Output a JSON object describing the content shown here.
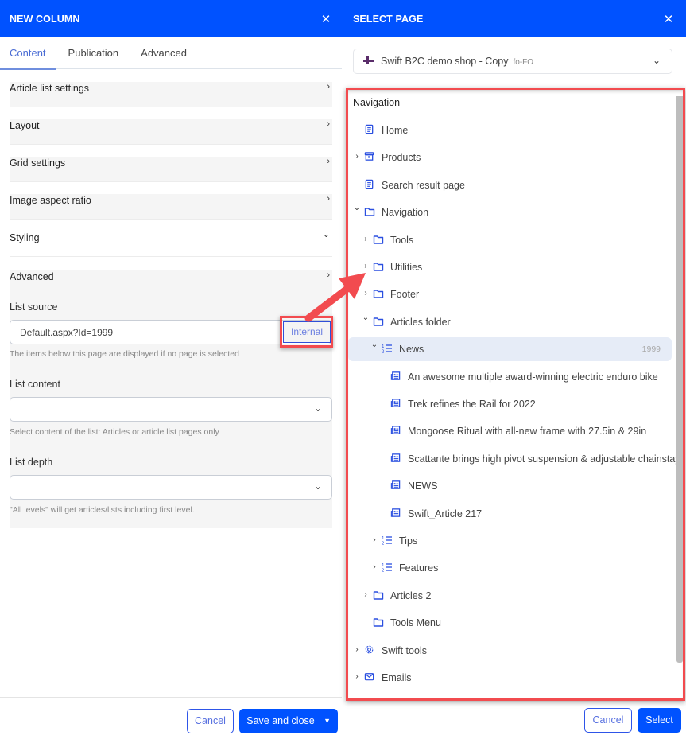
{
  "left_panel": {
    "title": "NEW COLUMN",
    "close_icon": "close-icon",
    "tabs": [
      {
        "label": "Content",
        "active": true
      },
      {
        "label": "Publication",
        "active": false
      },
      {
        "label": "Advanced",
        "active": false
      }
    ],
    "sections": [
      {
        "label": "Article list settings",
        "state": "collapsed",
        "chevron": "›"
      },
      {
        "label": "Layout",
        "state": "collapsed",
        "chevron": "›"
      },
      {
        "label": "Grid settings",
        "state": "collapsed",
        "chevron": "›"
      },
      {
        "label": "Image aspect ratio",
        "state": "collapsed",
        "chevron": "›"
      },
      {
        "label": "Styling",
        "state": "expanded",
        "chevron": "⌄"
      }
    ],
    "advanced": {
      "label": "Advanced",
      "chevron": "›",
      "list_source": {
        "label": "List source",
        "value": "Default.aspx?Id=1999",
        "button": "Internal",
        "help": "The items below this page are displayed if no page is selected"
      },
      "list_content": {
        "label": "List content",
        "value": "",
        "help": "Select content of the list: Articles or article list pages only"
      },
      "list_depth": {
        "label": "List depth",
        "value": "",
        "help": "\"All levels\" will get articles/lists including first level."
      }
    },
    "footer": {
      "cancel": "Cancel",
      "save": "Save and close",
      "save_caret": "▼"
    }
  },
  "right_panel": {
    "title": "SELECT PAGE",
    "shop": {
      "name": "Swift B2C demo shop - Copy",
      "language": "fo-FO",
      "flag": "faroe-islands-flag"
    },
    "tree": {
      "heading": "Navigation",
      "nodes": [
        {
          "label": "Home",
          "icon": "page-icon",
          "level": 0,
          "toggle": "",
          "selected": false
        },
        {
          "label": "Products",
          "icon": "archive-icon",
          "level": 0,
          "toggle": "›",
          "selected": false
        },
        {
          "label": "Search result page",
          "icon": "page-icon",
          "level": 0,
          "toggle": "",
          "selected": false
        },
        {
          "label": "Navigation",
          "icon": "folder-icon",
          "level": 0,
          "toggle": "⌄",
          "selected": false
        },
        {
          "label": "Tools",
          "icon": "folder-icon",
          "level": 1,
          "toggle": "›",
          "selected": false
        },
        {
          "label": "Utilities",
          "icon": "folder-icon",
          "level": 1,
          "toggle": "›",
          "selected": false
        },
        {
          "label": "Footer",
          "icon": "folder-icon",
          "level": 1,
          "toggle": "›",
          "selected": false
        },
        {
          "label": "Articles folder",
          "icon": "folder-icon",
          "level": 1,
          "toggle": "⌄",
          "selected": false
        },
        {
          "label": "News",
          "icon": "list-icon",
          "level": 2,
          "toggle": "⌄",
          "selected": true,
          "page_id": "1999"
        },
        {
          "label": "An awesome multiple award-winning electric enduro bike",
          "icon": "article-icon",
          "level": 3,
          "toggle": "",
          "selected": false
        },
        {
          "label": "Trek refines the Rail for 2022",
          "icon": "article-icon",
          "level": 3,
          "toggle": "",
          "selected": false
        },
        {
          "label": "Mongoose Ritual with all-new frame with 27.5in & 29in",
          "icon": "article-icon",
          "level": 3,
          "toggle": "",
          "selected": false
        },
        {
          "label": "Scattante brings high pivot suspension & adjustable chainstay",
          "icon": "article-icon",
          "level": 3,
          "toggle": "",
          "selected": false
        },
        {
          "label": "NEWS",
          "icon": "article-icon",
          "level": 3,
          "toggle": "",
          "selected": false
        },
        {
          "label": "Swift_Article 217",
          "icon": "article-icon",
          "level": 3,
          "toggle": "",
          "selected": false
        },
        {
          "label": "Tips",
          "icon": "list-icon",
          "level": 2,
          "toggle": "›",
          "selected": false
        },
        {
          "label": "Features",
          "icon": "list-icon",
          "level": 2,
          "toggle": "›",
          "selected": false
        },
        {
          "label": "Articles 2",
          "icon": "folder-icon",
          "level": 1,
          "toggle": "›",
          "selected": false
        },
        {
          "label": "Tools Menu",
          "icon": "folder-icon",
          "level": 1,
          "toggle": "",
          "selected": false
        },
        {
          "label": "Swift tools",
          "icon": "gear-icon",
          "level": 0,
          "toggle": "›",
          "selected": false
        },
        {
          "label": "Emails",
          "icon": "mail-icon",
          "level": 0,
          "toggle": "›",
          "selected": false
        }
      ]
    },
    "footer": {
      "cancel": "Cancel",
      "select": "Select"
    }
  },
  "colors": {
    "brand": "#0052ff",
    "icon_blue": "#2a4fe0",
    "annotation_red": "#f24b4f",
    "selected_row": "#e6ecf7"
  }
}
